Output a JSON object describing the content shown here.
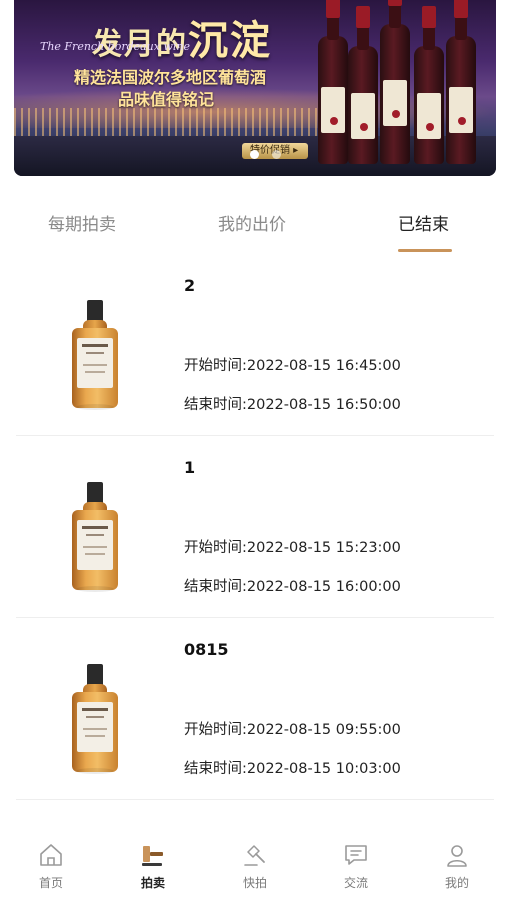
{
  "banner": {
    "title_prefix": "发月的",
    "title_big": "沉淀",
    "subtitle_en": "The French bordeaux wine",
    "line1": "精选法国波尔多地区葡萄酒",
    "line2": "品味值得铭记",
    "button": "特价促销 ▸"
  },
  "tabs": [
    {
      "label": "每期拍卖",
      "active": false
    },
    {
      "label": "我的出价",
      "active": false
    },
    {
      "label": "已结束",
      "active": true
    }
  ],
  "auctions": [
    {
      "title": "2",
      "start": "开始时间:2022-08-15 16:45:00",
      "end": "结束时间:2022-08-15 16:50:00"
    },
    {
      "title": "1",
      "start": "开始时间:2022-08-15 15:23:00",
      "end": "结束时间:2022-08-15 16:00:00"
    },
    {
      "title": "0815",
      "start": "开始时间:2022-08-15 09:55:00",
      "end": "结束时间:2022-08-15 10:03:00"
    }
  ],
  "nav": [
    {
      "label": "首页",
      "icon": "home-icon",
      "active": false
    },
    {
      "label": "拍卖",
      "icon": "gavel-icon",
      "active": true
    },
    {
      "label": "快拍",
      "icon": "quick-auction-icon",
      "active": false
    },
    {
      "label": "交流",
      "icon": "chat-icon",
      "active": false
    },
    {
      "label": "我的",
      "icon": "user-icon",
      "active": false
    }
  ],
  "colors": {
    "accent": "#c9935a",
    "active_icon": "#c9935a"
  }
}
